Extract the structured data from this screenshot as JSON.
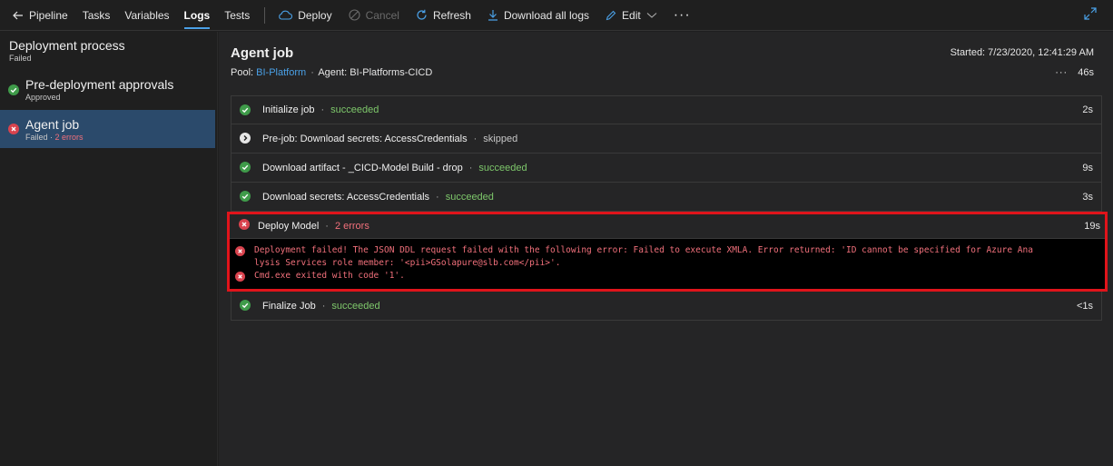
{
  "toolbar": {
    "back_label": "Pipeline",
    "tabs": [
      "Tasks",
      "Variables",
      "Logs",
      "Tests"
    ],
    "deploy_label": "Deploy",
    "cancel_label": "Cancel",
    "refresh_label": "Refresh",
    "download_label": "Download all logs",
    "edit_label": "Edit",
    "more_label": "···"
  },
  "sidebar": {
    "items": [
      {
        "title": "Deployment process",
        "status": "Failed"
      },
      {
        "title": "Pre-deployment approvals",
        "status": "Approved"
      },
      {
        "title": "Agent job",
        "status": "Failed",
        "errors": "2 errors"
      }
    ]
  },
  "job": {
    "title": "Agent job",
    "started": "Started: 7/23/2020, 12:41:29 AM",
    "pool_prefix": "Pool:",
    "pool": "BI-Platform",
    "agent": "Agent: BI-Platforms-CICD",
    "more": "···",
    "duration": "46s"
  },
  "steps": [
    {
      "name": "Initialize job",
      "status": "succeeded",
      "duration": "2s"
    },
    {
      "name": "Pre-job: Download secrets: AccessCredentials",
      "status": "skipped",
      "duration": ""
    },
    {
      "name": "Download artifact - _CICD-Model Build - drop",
      "status": "succeeded",
      "duration": "9s"
    },
    {
      "name": "Download secrets: AccessCredentials",
      "status": "succeeded",
      "duration": "3s"
    },
    {
      "name": "Deploy Model",
      "status": "2 errors",
      "duration": "19s"
    },
    {
      "name": "Finalize Job",
      "status": "succeeded",
      "duration": "<1s"
    }
  ],
  "errors": {
    "line1a": "Deployment failed! The JSON DDL request failed with the following error: Failed to execute XMLA. Error returned: 'ID cannot be specified for Azure Ana",
    "line1b": "lysis Services role member: '<pii>GSolapure@slb.com</pii>'.",
    "line2": "Cmd.exe exited with code '1'."
  },
  "colors": {
    "accent": "#4aa0e6",
    "success": "#7ec86b",
    "error": "#f1707b",
    "highlight": "#e0141b",
    "selected": "#2b4a6b"
  }
}
